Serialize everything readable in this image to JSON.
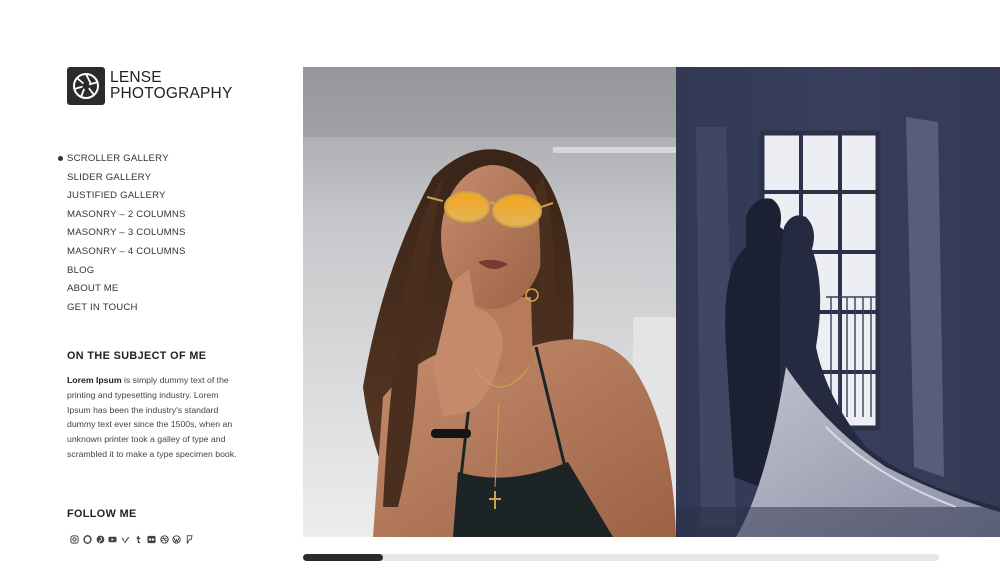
{
  "logo": {
    "line1": "LENSE",
    "line2": "PHOTOGRAPHY"
  },
  "nav": {
    "items": [
      {
        "label": "SCROLLER GALLERY",
        "active": true
      },
      {
        "label": "SLIDER GALLERY"
      },
      {
        "label": "JUSTIFIED GALLERY"
      },
      {
        "label": "MASONRY – 2 COLUMNS"
      },
      {
        "label": "MASONRY – 3 COLUMNS"
      },
      {
        "label": "MASONRY – 4 COLUMNS"
      },
      {
        "label": "BLOG"
      },
      {
        "label": "ABOUT ME"
      },
      {
        "label": "GET IN TOUCH"
      }
    ]
  },
  "about": {
    "title": "ON THE SUBJECT OF ME",
    "bold": "Lorem Ipsum",
    "text": " is simply dummy text of the printing and typesetting industry. Lorem Ipsum has been the industry's standard dummy text ever since the 1500s, when an unknown printer took a galley of type and scrambled it to make a type specimen book."
  },
  "follow": {
    "title": "FOLLOW ME",
    "icons": [
      "instagram-icon",
      "opera-icon",
      "pinterest-icon",
      "youtube-icon",
      "vimeo-icon",
      "tumblr-icon",
      "flickr-icon",
      "dribbble-icon",
      "wordpress-icon",
      "foursquare-icon"
    ]
  },
  "gallery": {
    "photos": [
      "woman-with-orange-sunglasses",
      "wedding-couple-silhouette-at-window"
    ]
  },
  "scroll": {
    "position_fraction": 0.126
  },
  "colors": {
    "accent": "#2b2b2b",
    "track": "#e7e7e7",
    "dark_photo_bg": "#3b4160"
  }
}
